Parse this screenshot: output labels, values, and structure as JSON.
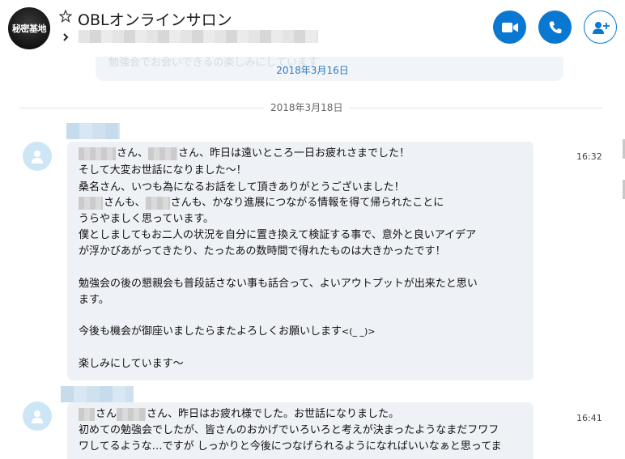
{
  "conversation": {
    "avatar_text": "秘密基地",
    "title": "OBLオンラインサロン"
  },
  "icons": {
    "star": "star-outline-icon",
    "chevron": "chevron-right-icon",
    "video": "video-call-icon",
    "call": "phone-icon",
    "add_people": "add-person-icon"
  },
  "colors": {
    "accent": "#0a78d1",
    "bubble": "#eef1f5",
    "date": "#2b7bbf"
  },
  "history": {
    "ghost_text": "勉強会でお会いできるの楽しみにしています",
    "date_top": "2018年3月16日"
  },
  "divider": {
    "date": "2018年3月18日"
  },
  "messages": [
    {
      "time": "16:32",
      "line0_a": "さん、",
      "line0_b": "さん、昨日は遠いところ一日お疲れさまでした！",
      "lines": [
        "そして大変お世話になりました～！",
        "桑名さん、いつも為になるお話をして頂きありがとうございました！"
      ],
      "line3_a": "さんも、",
      "line3_b": "さんも、かなり進展につながる情報を得て帰られたことに",
      "lines2": [
        "うらやましく思っています。",
        "僕としましてもお二人の状況を自分に置き換えて検証する事で、意外と良いアイデア",
        "が浮かびあがってきたり、たったあの数時間で得れたものは大きかったです！",
        "勉強会の後の懇親会も普段話さない事も話合って、よいアウトプットが出来たと思い",
        "ます。",
        "今後も機会が御座いましたらまたよろしくお願いします",
        "楽しみにしています～"
      ],
      "emoticon": "<(_ _)>"
    },
    {
      "time": "16:41",
      "line0_a": "さん",
      "line0_b": "さん、昨日はお疲れ様でした。お世話になりました。",
      "lines": [
        "初めての勉強会でしたが、皆さんのおかげでいろいろと考えが決まったようなまだフワフ",
        "ワしてるような…ですが しっかりと今後につなげられるようになればいいなぁと思ってま"
      ]
    }
  ]
}
